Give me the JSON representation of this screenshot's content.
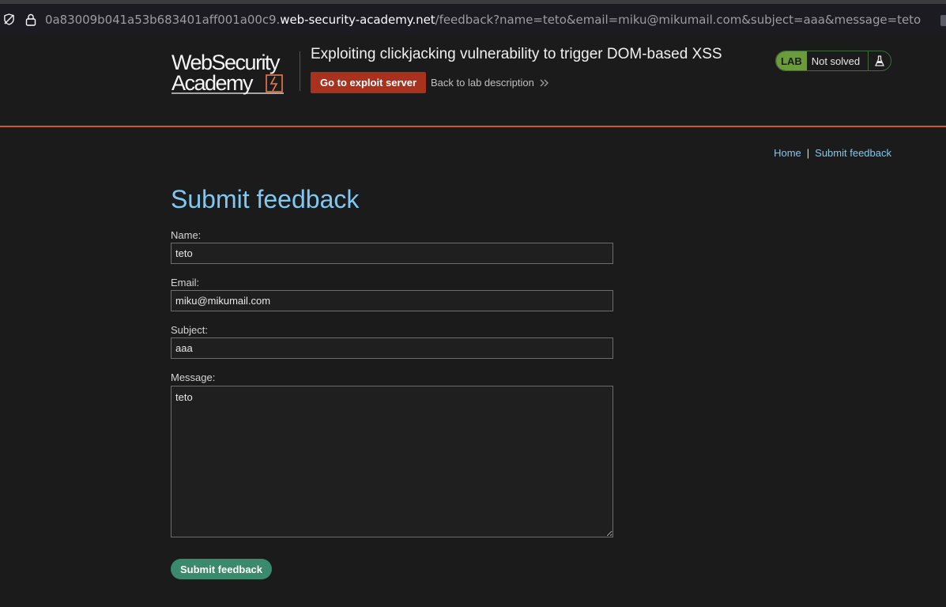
{
  "browser": {
    "url_prefix": "0a83009b041a53b683401aff001a00c9.",
    "url_host": "web-security-academy.net",
    "url_path": "/feedback?name=teto&email=miku@mikumail.com&subject=aaa&message=teto",
    "icons": [
      "tracking-shield-icon",
      "lock-icon"
    ]
  },
  "header": {
    "logo_line1": "WebSecurity",
    "logo_line2": "Academy",
    "lab_title": "Exploiting clickjacking vulnerability to trigger DOM-based XSS",
    "exploit_button": "Go to exploit server",
    "back_link": "Back to lab description",
    "lab_badge": "LAB",
    "lab_state": "Not solved",
    "accent_color": "#ce5a28"
  },
  "nav": {
    "home": "Home",
    "separator": "|",
    "submit_feedback": "Submit feedback"
  },
  "page": {
    "title": "Submit feedback"
  },
  "form": {
    "name_label": "Name:",
    "name_value": "teto",
    "email_label": "Email:",
    "email_value": "miku@mikumail.com",
    "subject_label": "Subject:",
    "subject_value": "aaa",
    "message_label": "Message:",
    "message_value": "teto",
    "submit_label": "Submit feedback"
  }
}
